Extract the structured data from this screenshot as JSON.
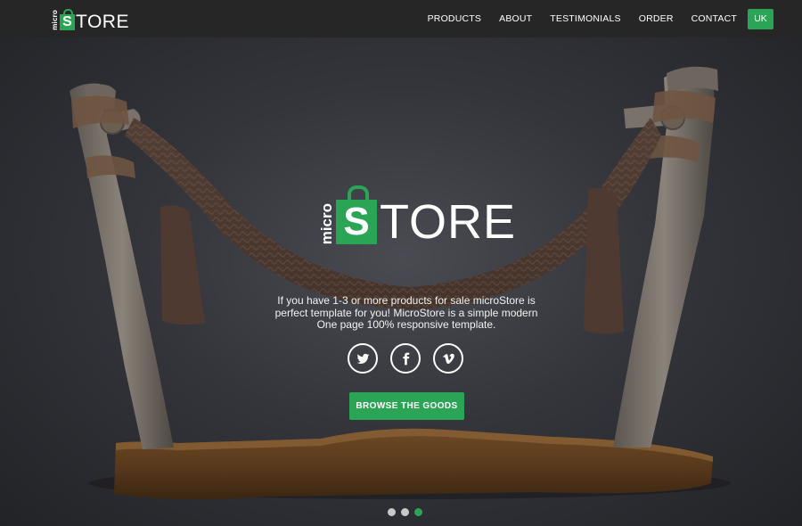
{
  "brand": {
    "logo_micro": "micro",
    "logo_letter": "S",
    "logo_rest": "TORE"
  },
  "nav": {
    "items": [
      {
        "label": "PRODUCTS"
      },
      {
        "label": "ABOUT"
      },
      {
        "label": "TESTIMONIALS"
      },
      {
        "label": "ORDER"
      },
      {
        "label": "CONTACT"
      }
    ],
    "language": "UK"
  },
  "hero": {
    "logo_micro": "micro",
    "logo_letter": "S",
    "logo_rest": "TORE",
    "tagline_lines": [
      "If you have 1-3 or more products for sale microStore is",
      "perfect template for you! MicroStore is a simple modern",
      "One page 100% responsive template."
    ],
    "socials": [
      {
        "icon": "twitter-icon"
      },
      {
        "icon": "facebook-icon"
      },
      {
        "icon": "vimeo-icon"
      }
    ],
    "cta_label": "BROWSE THE GOODS"
  },
  "slider": {
    "total": 3,
    "active_index": 2
  },
  "colors": {
    "accent": "#2aa556",
    "header_bg": "#262626",
    "hero_bg": "#34353b"
  }
}
